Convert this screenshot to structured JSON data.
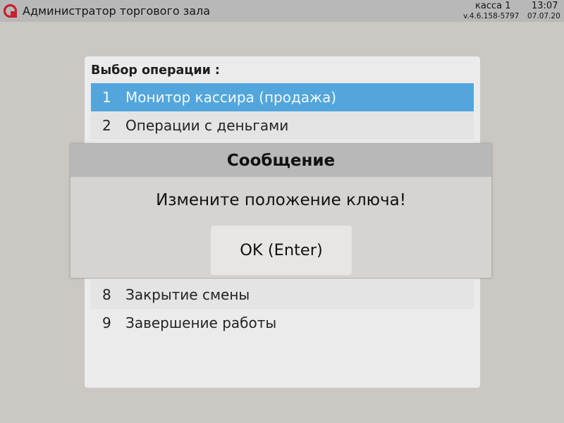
{
  "topbar": {
    "app_title": "Администратор торгового зала",
    "register": "касса 1",
    "time": "13:07",
    "version": "v.4.6.158-5797",
    "date": "07.07.20",
    "logo_icon": "brand-logo-icon",
    "logo_color": "#c8202e"
  },
  "menu": {
    "title": "Выбор операции :",
    "items": [
      {
        "number": "1",
        "label": "Монитор кассира (продажа)",
        "selected": true
      },
      {
        "number": "2",
        "label": "Операции с деньгами",
        "selected": false
      },
      {
        "number": "8",
        "label": "Закрытие смены",
        "selected": false
      },
      {
        "number": "9",
        "label": "Завершение работы",
        "selected": false
      }
    ],
    "selected_color": "#52a6db"
  },
  "dialog": {
    "title": "Сообщение",
    "message": "Измените положение ключа!",
    "ok_label": "OK (Enter)"
  }
}
